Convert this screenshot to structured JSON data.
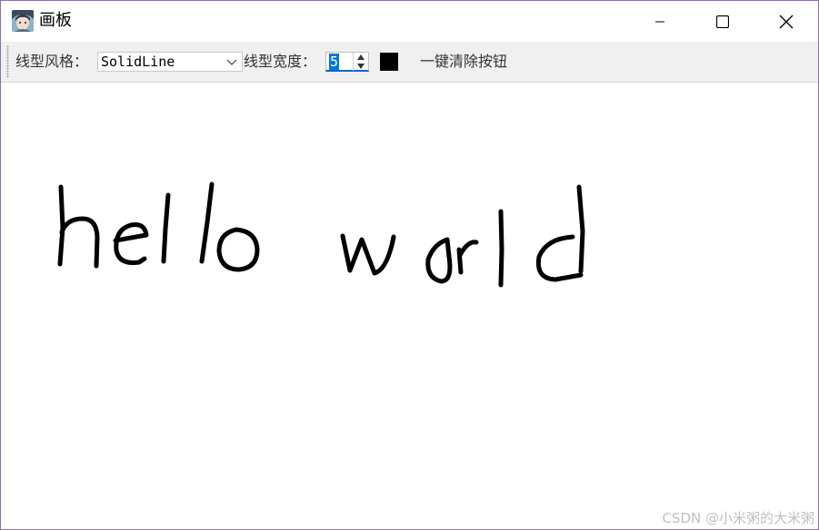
{
  "window": {
    "title": "画板",
    "icon": "avatar-app-icon"
  },
  "title_bar": {
    "buttons": [
      "minimize-icon",
      "maximize-icon",
      "close-icon"
    ]
  },
  "toolbar": {
    "line_style_label": "线型风格：",
    "line_style_value": "SolidLine",
    "line_width_label": "线型宽度：",
    "line_width_value": "5",
    "pen_color": "#000000",
    "clear_button_label": "一键清除按钮"
  },
  "canvas": {
    "drawn_text": "hello world",
    "stroke_color": "#000000"
  },
  "watermark": "CSDN @小米粥的大米粥"
}
